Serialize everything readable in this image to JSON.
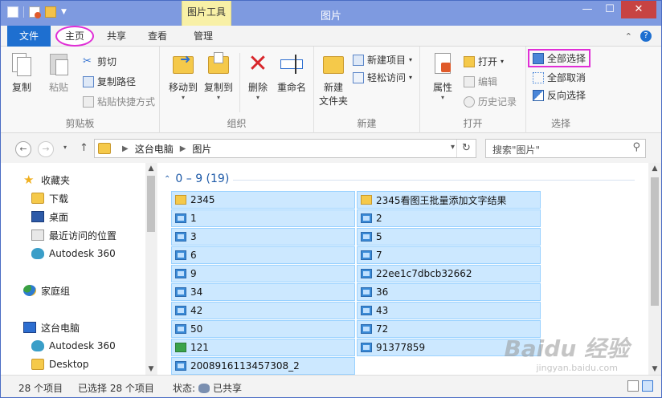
{
  "window": {
    "title": "图片",
    "context_tab_header": "图片工具",
    "minimize": "—",
    "maximize": "☐",
    "close": "✕"
  },
  "tabs": {
    "file": "文件",
    "home": "主页",
    "share": "共享",
    "view": "查看",
    "manage": "管理"
  },
  "ribbon": {
    "clipboard": {
      "label": "剪贴板",
      "copy": "复制",
      "paste": "粘贴",
      "cut": "剪切",
      "copy_path": "复制路径",
      "paste_shortcut": "粘贴快捷方式"
    },
    "organize": {
      "label": "组织",
      "move_to": "移动到",
      "copy_to": "复制到",
      "delete": "删除",
      "rename": "重命名"
    },
    "new": {
      "label": "新建",
      "new_folder": "新建\n文件夹",
      "new_folder_line1": "新建",
      "new_folder_line2": "文件夹",
      "new_item": "新建项目",
      "easy_access": "轻松访问"
    },
    "open": {
      "label": "打开",
      "properties": "属性",
      "open": "打开",
      "edit": "编辑",
      "history": "历史记录"
    },
    "select": {
      "label": "选择",
      "select_all": "全部选择",
      "select_none": "全部取消",
      "invert": "反向选择"
    }
  },
  "address": {
    "crumbs": [
      "这台电脑",
      "图片"
    ],
    "search_placeholder": "搜索\"图片\""
  },
  "nav": {
    "favorites": "收藏夹",
    "downloads": "下载",
    "desktop": "桌面",
    "recent": "最近访问的位置",
    "autodesk1": "Autodesk 360",
    "homegroup": "家庭组",
    "this_pc": "这台电脑",
    "autodesk2": "Autodesk 360",
    "desktop2": "Desktop"
  },
  "content": {
    "group_header": "0 – 9 (19)",
    "items": [
      {
        "name": "2345",
        "type": "folder"
      },
      {
        "name": "2345看图王批量添加文字结果",
        "type": "folder"
      },
      {
        "name": "1",
        "type": "jpg"
      },
      {
        "name": "2",
        "type": "jpg"
      },
      {
        "name": "3",
        "type": "jpg"
      },
      {
        "name": "5",
        "type": "jpg"
      },
      {
        "name": "6",
        "type": "jpg"
      },
      {
        "name": "7",
        "type": "jpg"
      },
      {
        "name": "9",
        "type": "jpg"
      },
      {
        "name": "22ee1c7dbcb32662",
        "type": "jpg"
      },
      {
        "name": "34",
        "type": "jpg"
      },
      {
        "name": "36",
        "type": "jpg"
      },
      {
        "name": "42",
        "type": "jpg"
      },
      {
        "name": "43",
        "type": "jpg"
      },
      {
        "name": "50",
        "type": "jpg"
      },
      {
        "name": "72",
        "type": "jpg"
      },
      {
        "name": "121",
        "type": "bmp"
      },
      {
        "name": "91377859",
        "type": "jpg"
      },
      {
        "name": "2008916113457308_2",
        "type": "jpg"
      }
    ]
  },
  "status": {
    "count": "28 个项目",
    "selected": "已选择 28 个项目",
    "state_label": "状态:",
    "state_value": "已共享"
  },
  "watermark": {
    "brand": "Baidu 经验",
    "url": "jingyan.baidu.com"
  },
  "colors": {
    "titlebar": "#7e9ae0",
    "file_tab": "#1e6fd0",
    "selection": "#cce8ff",
    "highlight": "#e02ed6"
  }
}
